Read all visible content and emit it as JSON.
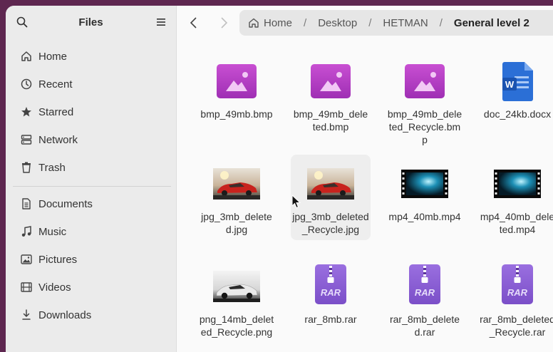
{
  "sidebar": {
    "title": "Files",
    "places": [
      {
        "label": "Home",
        "icon": "home-icon"
      },
      {
        "label": "Recent",
        "icon": "clock-icon"
      },
      {
        "label": "Starred",
        "icon": "star-icon"
      },
      {
        "label": "Network",
        "icon": "network-icon"
      },
      {
        "label": "Trash",
        "icon": "trash-icon"
      }
    ],
    "folders": [
      {
        "label": "Documents",
        "icon": "document-icon"
      },
      {
        "label": "Music",
        "icon": "music-icon"
      },
      {
        "label": "Pictures",
        "icon": "picture-icon"
      },
      {
        "label": "Videos",
        "icon": "film-icon"
      },
      {
        "label": "Downloads",
        "icon": "download-icon"
      }
    ]
  },
  "path": {
    "crumbs": [
      "Home",
      "Desktop",
      "HETMAN",
      "General level 2"
    ]
  },
  "files": [
    {
      "name": "bmp_49mb.bmp",
      "type": "image"
    },
    {
      "name": "bmp_49mb_deleted.bmp",
      "type": "image"
    },
    {
      "name": "bmp_49mb_deleted_Recycle.bmp",
      "type": "image"
    },
    {
      "name": "doc_24kb.docx",
      "type": "word"
    },
    {
      "name": "jpg_3mb_deleted.jpg",
      "type": "photo-car-red"
    },
    {
      "name": "jpg_3mb_deleted_Recycle.jpg",
      "type": "photo-car-red"
    },
    {
      "name": "mp4_40mb.mp4",
      "type": "video"
    },
    {
      "name": "mp4_40mb_deleted.mp4",
      "type": "video"
    },
    {
      "name": "png_14mb_deleted_Recycle.png",
      "type": "photo-car-white"
    },
    {
      "name": "rar_8mb.rar",
      "type": "rar"
    },
    {
      "name": "rar_8mb_deleted.rar",
      "type": "rar"
    },
    {
      "name": "rar_8mb_deleted_Recycle.rar",
      "type": "rar"
    }
  ],
  "icons": {
    "rar_label": "RAR",
    "word_letter": "W"
  },
  "colors": {
    "image_icon": "#b23fc0",
    "rar_icon": "#8a5fd0",
    "word_icon": "#2b6fd6"
  }
}
